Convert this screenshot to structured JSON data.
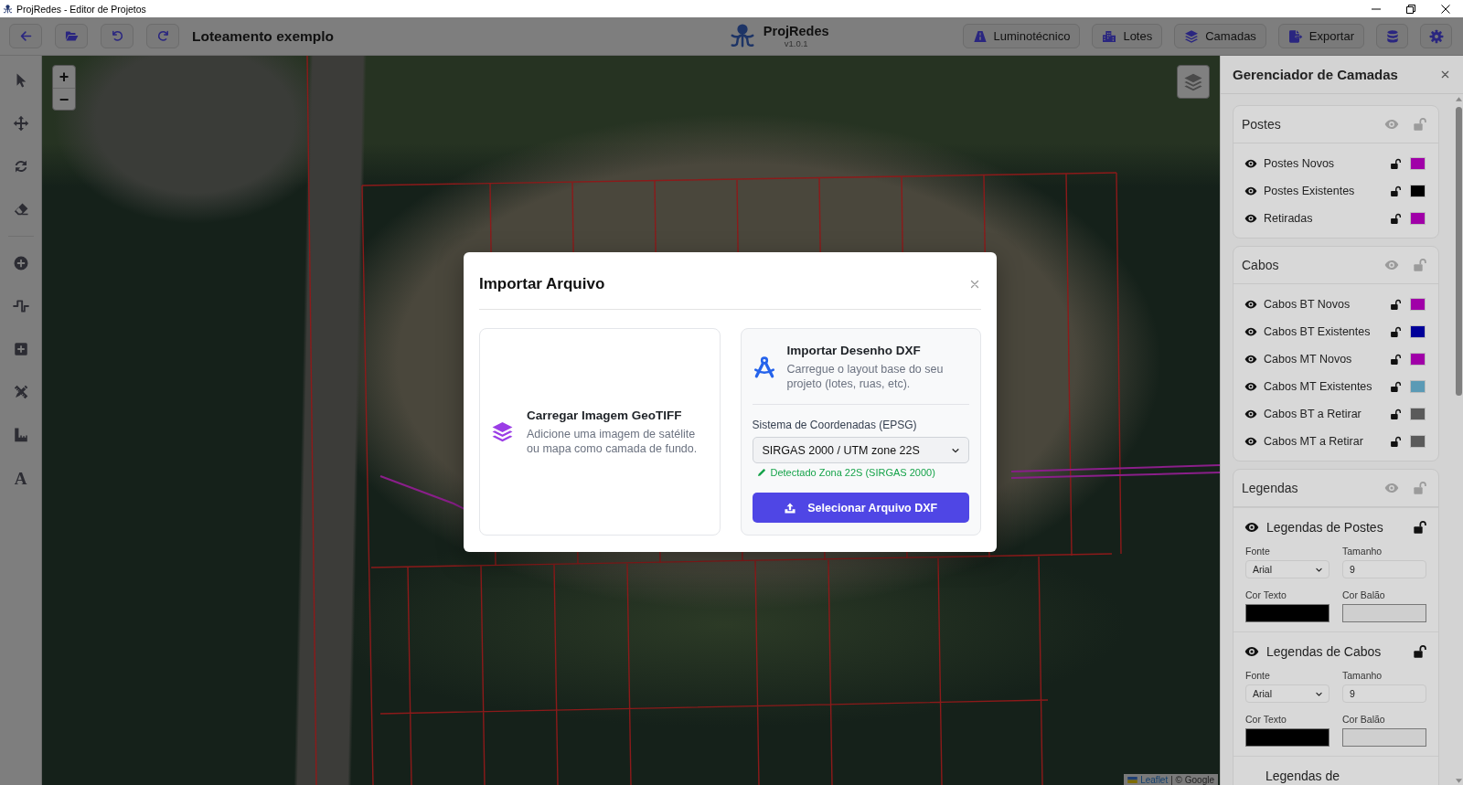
{
  "window": {
    "title": "ProjRedes - Editor de Projetos"
  },
  "header": {
    "project_title": "Loteamento exemplo",
    "app_name": "ProjRedes",
    "version": "v1.0.1",
    "actions": [
      {
        "label": "Luminotécnico"
      },
      {
        "label": "Lotes"
      },
      {
        "label": "Camadas"
      },
      {
        "label": "Exportar"
      }
    ]
  },
  "toolbar": {
    "groups": [
      [
        {
          "selected": false
        },
        {
          "selected": false
        },
        {
          "selected": false
        },
        {
          "selected": false
        }
      ],
      [
        {
          "selected": false
        },
        {
          "selected": false
        },
        {
          "selected": false
        },
        {
          "selected": false
        },
        {
          "selected": false
        },
        {
          "selected": false,
          "glyph": "A"
        }
      ]
    ]
  },
  "map": {
    "zoom_in": "+",
    "zoom_out": "−",
    "attribution_link": "Leaflet",
    "attribution_text": "| © Google"
  },
  "layers_panel": {
    "title": "Gerenciador de Camadas",
    "sections": [
      {
        "kind": "layers",
        "title": "Postes",
        "visible": true,
        "locked": false,
        "layers": [
          {
            "label": "Postes Novos",
            "visible": true,
            "locked": false,
            "color": "#a000a8"
          },
          {
            "label": "Postes Existentes",
            "visible": true,
            "locked": false,
            "color": "#000000"
          },
          {
            "label": "Retiradas",
            "visible": true,
            "locked": false,
            "color": "#a000a8"
          }
        ]
      },
      {
        "kind": "layers",
        "title": "Cabos",
        "visible": true,
        "locked": false,
        "layers": [
          {
            "label": "Cabos BT Novos",
            "visible": true,
            "locked": false,
            "color": "#a000a8"
          },
          {
            "label": "Cabos BT Existentes",
            "visible": true,
            "locked": false,
            "color": "#000099"
          },
          {
            "label": "Cabos MT Novos",
            "visible": true,
            "locked": false,
            "color": "#a000a8"
          },
          {
            "label": "Cabos MT Existentes",
            "visible": true,
            "locked": false,
            "color": "#5b9ab5"
          },
          {
            "label": "Cabos BT a Retirar",
            "visible": true,
            "locked": false,
            "color": "#5a5a5a"
          },
          {
            "label": "Cabos MT a Retirar",
            "visible": true,
            "locked": false,
            "color": "#5a5a5a"
          }
        ]
      },
      {
        "kind": "labels",
        "title": "Legendas",
        "visible": true,
        "locked": false,
        "groups": [
          {
            "title": "Legendas de Postes",
            "visible": true,
            "locked": false,
            "fields": [
              {
                "kind": "select",
                "label": "Fonte",
                "value": "Arial"
              },
              {
                "kind": "number",
                "label": "Tamanho",
                "value": "9"
              },
              {
                "kind": "color",
                "label": "Cor Texto",
                "color": "#000000"
              },
              {
                "kind": "color",
                "label": "Cor Balão",
                "color": "#cfcfcf"
              }
            ]
          },
          {
            "title": "Legendas de Cabos",
            "visible": true,
            "locked": false,
            "fields": [
              {
                "kind": "select",
                "label": "Fonte",
                "value": "Arial"
              },
              {
                "kind": "number",
                "label": "Tamanho",
                "value": "9"
              },
              {
                "kind": "color",
                "label": "Cor Texto",
                "color": "#000000"
              },
              {
                "kind": "color",
                "label": "Cor Balão",
                "color": "#cfcfcf"
              }
            ]
          },
          {
            "title": "Legendas de"
          }
        ]
      }
    ]
  },
  "modal": {
    "title": "Importar Arquivo",
    "options": [
      {
        "kind": "geotiff",
        "title": "Carregar Imagem GeoTIFF",
        "description": "Adicione uma imagem de satélite ou mapa como camada de fundo."
      },
      {
        "kind": "dxf",
        "title": "Importar Desenho DXF",
        "description": "Carregue o layout base do seu projeto (lotes, ruas, etc).",
        "crs_label": "Sistema de Coordenadas (EPSG)",
        "crs_value": "SIRGAS 2000 / UTM zone 22S",
        "detected": "Detectado Zona 22S (SIRGAS 2000)",
        "button": "Selecionar Arquivo DXF"
      }
    ]
  }
}
